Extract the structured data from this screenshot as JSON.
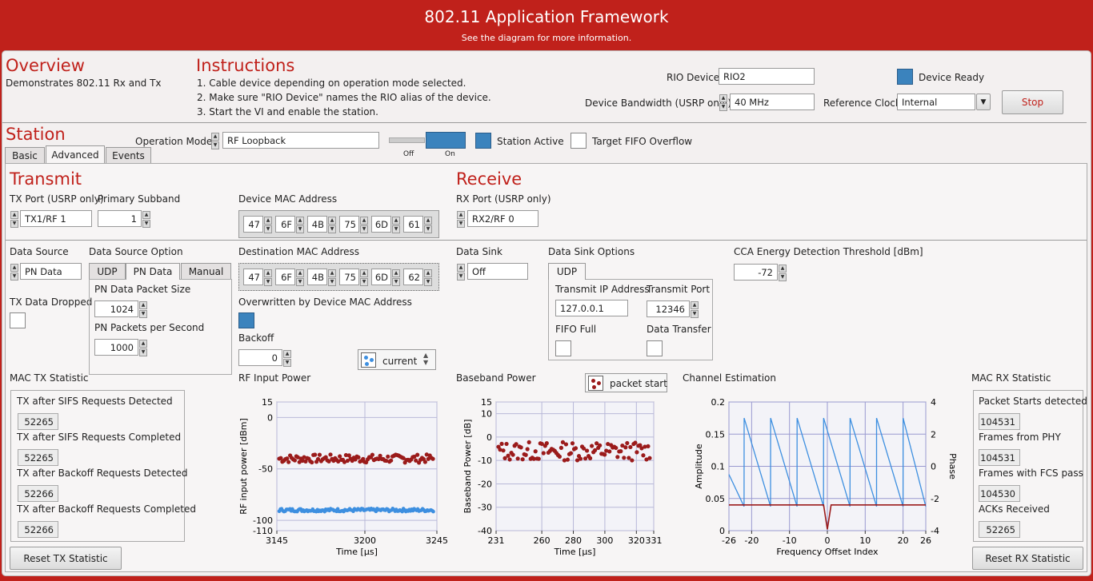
{
  "header": {
    "title": "802.11 Application Framework",
    "subtitle": "See the diagram for more information."
  },
  "overview": {
    "heading": "Overview",
    "text": "Demonstrates 802.11 Rx and Tx"
  },
  "instructions": {
    "heading": "Instructions",
    "steps": [
      "1. Cable device depending on operation mode selected.",
      "2. Make sure \"RIO Device\" names the RIO alias of the device.",
      "3. Start the VI and enable the station."
    ]
  },
  "device": {
    "rio_label": "RIO Device",
    "rio_value": "RIO2",
    "bw_label": "Device Bandwidth (USRP only)",
    "bw_value": "40 MHz",
    "ready_label": "Device Ready",
    "refclk_label": "Reference Clock",
    "refclk_value": "Internal",
    "stop_label": "Stop"
  },
  "station": {
    "heading": "Station",
    "opmode_label": "Operation Mode",
    "opmode_value": "RF Loopback",
    "switch_off": "Off",
    "switch_on": "On",
    "active_label": "Station Active",
    "fifo_label": "Target FIFO Overflow",
    "tabs": [
      "Basic",
      "Advanced",
      "Events"
    ]
  },
  "transmit": {
    "heading": "Transmit",
    "txport_label": "TX Port (USRP only)",
    "txport_value": "TX1/RF 1",
    "subband_label": "Primary Subband",
    "subband_value": "1",
    "dev_mac_label": "Device MAC Address",
    "dev_mac": [
      "47",
      "6F",
      "4B",
      "75",
      "6D",
      "61"
    ],
    "dst_mac_label": "Destination MAC Address",
    "dst_mac": [
      "47",
      "6F",
      "4B",
      "75",
      "6D",
      "62"
    ],
    "overwritten_label": "Overwritten by Device MAC Address",
    "backoff_label": "Backoff",
    "backoff_value": "0",
    "datasource_label": "Data Source",
    "datasource_value": "PN Data",
    "dso_label": "Data Source Option",
    "dso_tabs": [
      "UDP",
      "PN Data",
      "Manual"
    ],
    "pn_size_label": "PN Data Packet Size",
    "pn_size_value": "1024",
    "pn_pps_label": "PN Packets per Second",
    "pn_pps_value": "1000",
    "txdrop_label": "TX Data Dropped"
  },
  "receive": {
    "heading": "Receive",
    "rxport_label": "RX Port (USRP only)",
    "rxport_value": "RX2/RF 0",
    "sink_label": "Data Sink",
    "sink_value": "Off",
    "sink_opt_label": "Data Sink Options",
    "sink_tab": "UDP",
    "ip_label": "Transmit IP Address",
    "ip_value": "127.0.0.1",
    "port_label": "Transmit Port",
    "port_value": "12346",
    "fifo_full_label": "FIFO Full",
    "data_transfer_label": "Data Transfer",
    "cca_label": "CCA Energy Detection Threshold [dBm]",
    "cca_value": "-72"
  },
  "mac_tx": {
    "heading": "MAC TX Statistic",
    "items": [
      {
        "label": "TX after SIFS Requests Detected",
        "value": "52265"
      },
      {
        "label": "TX after SIFS Requests Completed",
        "value": "52265"
      },
      {
        "label": "TX after Backoff Requests Detected",
        "value": "52266"
      },
      {
        "label": "TX after Backoff Requests Completed",
        "value": "52266"
      }
    ],
    "reset": "Reset TX Statistic"
  },
  "mac_rx": {
    "heading": "MAC RX Statistic",
    "items": [
      {
        "label": "Packet Starts detected",
        "value": "104531"
      },
      {
        "label": "Frames from PHY",
        "value": "104531"
      },
      {
        "label": "Frames with FCS pass",
        "value": "104530"
      },
      {
        "label": "ACKs Received",
        "value": "52265"
      }
    ],
    "reset": "Reset RX Statistic"
  },
  "legends": {
    "current": "current",
    "packet_start": "packet start"
  },
  "colors": {
    "header": "#c0211b",
    "led_on": "#3b83bd",
    "series_red": "#9b1b1b",
    "series_blue": "#3d8fe0"
  },
  "chart_data": [
    {
      "type": "scatter",
      "title": "RF Input Power",
      "xlabel": "Time [µs]",
      "ylabel": "RF input power [dBm]",
      "xlim": [
        3145,
        3245
      ],
      "ylim": [
        -110,
        15
      ],
      "xticks": [
        "3145",
        "3200",
        "3245"
      ],
      "yticks": [
        "15",
        "0",
        "-50",
        "-100",
        "-110"
      ],
      "series": [
        {
          "name": "",
          "color": "red",
          "level": -40,
          "spread": 4
        },
        {
          "name": "",
          "color": "blue",
          "level": -90,
          "spread": 1.5
        }
      ]
    },
    {
      "type": "scatter",
      "title": "Baseband Power",
      "xlabel": "Time [µs]",
      "ylabel": "Baseband Power [dB]",
      "xlim": [
        231,
        331
      ],
      "ylim": [
        -40,
        15
      ],
      "xticks": [
        "231",
        "260",
        "280",
        "300",
        "320",
        "331"
      ],
      "yticks": [
        "15",
        "10",
        "0",
        "-10",
        "-20",
        "-30",
        "-40"
      ],
      "series": [
        {
          "name": "packet start",
          "color": "red",
          "level": -6,
          "spread": 4
        }
      ]
    },
    {
      "type": "line",
      "title": "Channel Estimation",
      "xlabel": "Frequency Offset Index",
      "ylabel": "Amplitude",
      "y2label": "Phase",
      "xlim": [
        -26,
        26
      ],
      "ylim": [
        0,
        0.2
      ],
      "y2lim": [
        -4,
        4
      ],
      "xticks": [
        "-26",
        "-20",
        "-10",
        "0",
        "10",
        "20",
        "26"
      ],
      "yticks": [
        "0.2",
        "0.15",
        "0.1",
        "0.05",
        "0"
      ],
      "y2ticks": [
        "4",
        "2",
        "0",
        "-2",
        "-4"
      ],
      "series": [
        {
          "name": "Amplitude",
          "color": "red",
          "values_desc": "flat ≈0.04 with dip to 0 at index 0"
        },
        {
          "name": "Phase",
          "color": "blue",
          "values_desc": "sawtooth between -2.5 and 3"
        }
      ]
    }
  ]
}
